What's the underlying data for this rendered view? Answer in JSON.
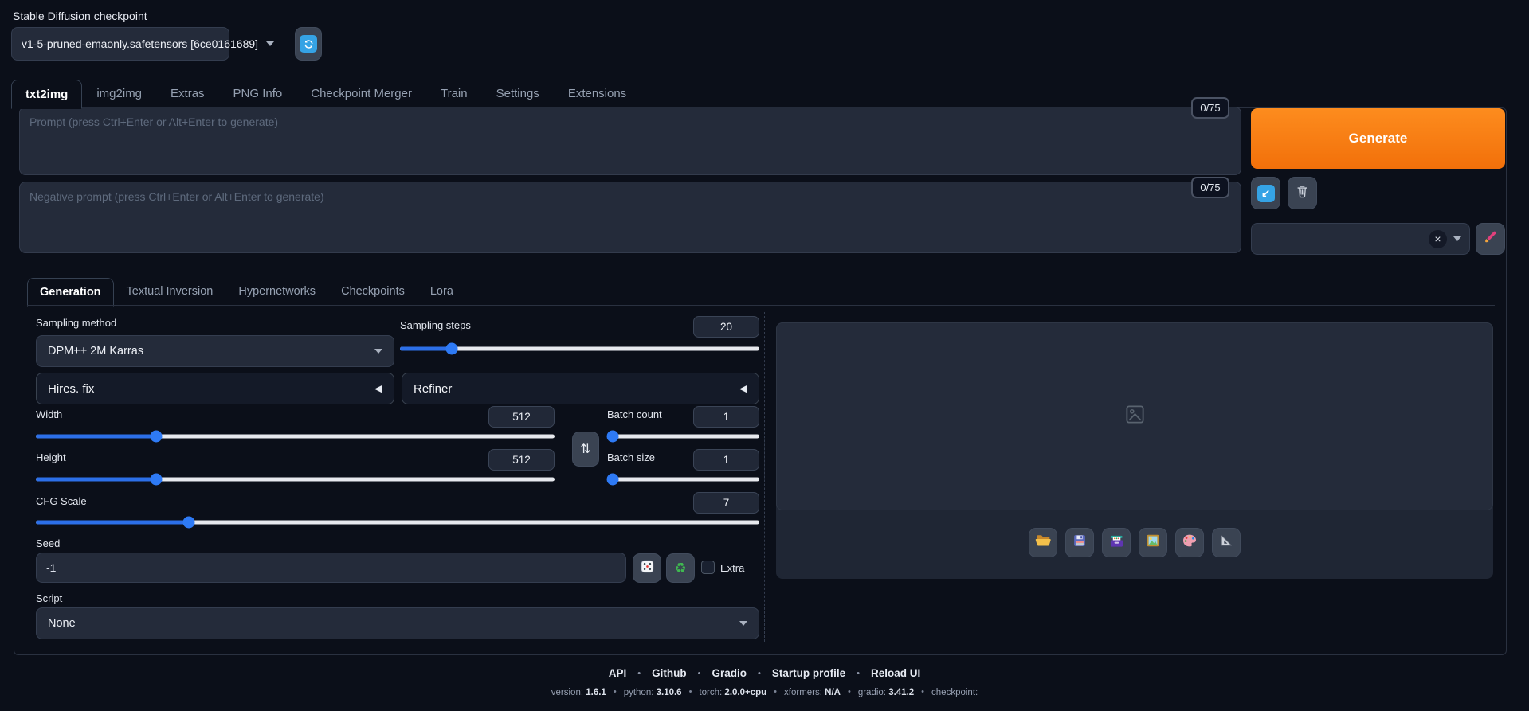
{
  "header": {
    "checkpoint_label": "Stable Diffusion checkpoint",
    "checkpoint_value": "v1-5-pruned-emaonly.safetensors [6ce0161689]",
    "refresh_icon": "refresh-icon"
  },
  "main_tabs": {
    "active": "txt2img",
    "items": [
      "txt2img",
      "img2img",
      "Extras",
      "PNG Info",
      "Checkpoint Merger",
      "Train",
      "Settings",
      "Extensions"
    ]
  },
  "prompts": {
    "positive_placeholder": "Prompt (press Ctrl+Enter or Alt+Enter to generate)",
    "negative_placeholder": "Negative prompt (press Ctrl+Enter or Alt+Enter to generate)",
    "positive_counter": "0/75",
    "negative_counter": "0/75"
  },
  "actions": {
    "generate_label": "Generate",
    "paste_icon": "paste-arrow-icon",
    "clear_icon": "trash-icon",
    "styles_clear_icon": "clear-x-icon",
    "styles_apply_icon": "paintbrush-icon"
  },
  "gen_tabs": {
    "active": "Generation",
    "items": [
      "Generation",
      "Textual Inversion",
      "Hypernetworks",
      "Checkpoints",
      "Lora"
    ]
  },
  "params": {
    "sampling_method": {
      "label": "Sampling method",
      "value": "DPM++ 2M Karras"
    },
    "sampling_steps": {
      "label": "Sampling steps",
      "value": "20",
      "fraction": 0.133
    },
    "hires_fix_label": "Hires. fix",
    "refiner_label": "Refiner",
    "width": {
      "label": "Width",
      "value": "512",
      "fraction": 0.226
    },
    "height": {
      "label": "Height",
      "value": "512",
      "fraction": 0.226
    },
    "batch_count": {
      "label": "Batch count",
      "value": "1",
      "fraction": 0
    },
    "batch_size": {
      "label": "Batch size",
      "value": "1",
      "fraction": 0
    },
    "cfg_scale": {
      "label": "CFG Scale",
      "value": "7",
      "fraction": 0.207
    },
    "seed": {
      "label": "Seed",
      "value": "-1",
      "extra_label": "Extra",
      "dice_icon": "dice-icon",
      "recycle_icon": "recycle-icon"
    },
    "script": {
      "label": "Script",
      "value": "None"
    }
  },
  "gallery_icons": [
    "open-folder-icon",
    "save-icon",
    "save-zip-icon",
    "send-to-img2img-icon",
    "send-to-inpaint-icon",
    "send-to-extras-icon"
  ],
  "footer": {
    "links": [
      "API",
      "Github",
      "Gradio",
      "Startup profile",
      "Reload UI"
    ],
    "version_parts": [
      [
        "version:",
        "1.6.1"
      ],
      [
        "python:",
        "3.10.6"
      ],
      [
        "torch:",
        "2.0.0+cpu"
      ],
      [
        "xformers:",
        "N/A"
      ],
      [
        "gradio:",
        "3.41.2"
      ],
      [
        "checkpoint:",
        ""
      ]
    ]
  },
  "colors": {
    "accent_orange": "#f2700a",
    "accent_blue": "#2e7af5",
    "refresh_blue": "#35a3e5"
  }
}
